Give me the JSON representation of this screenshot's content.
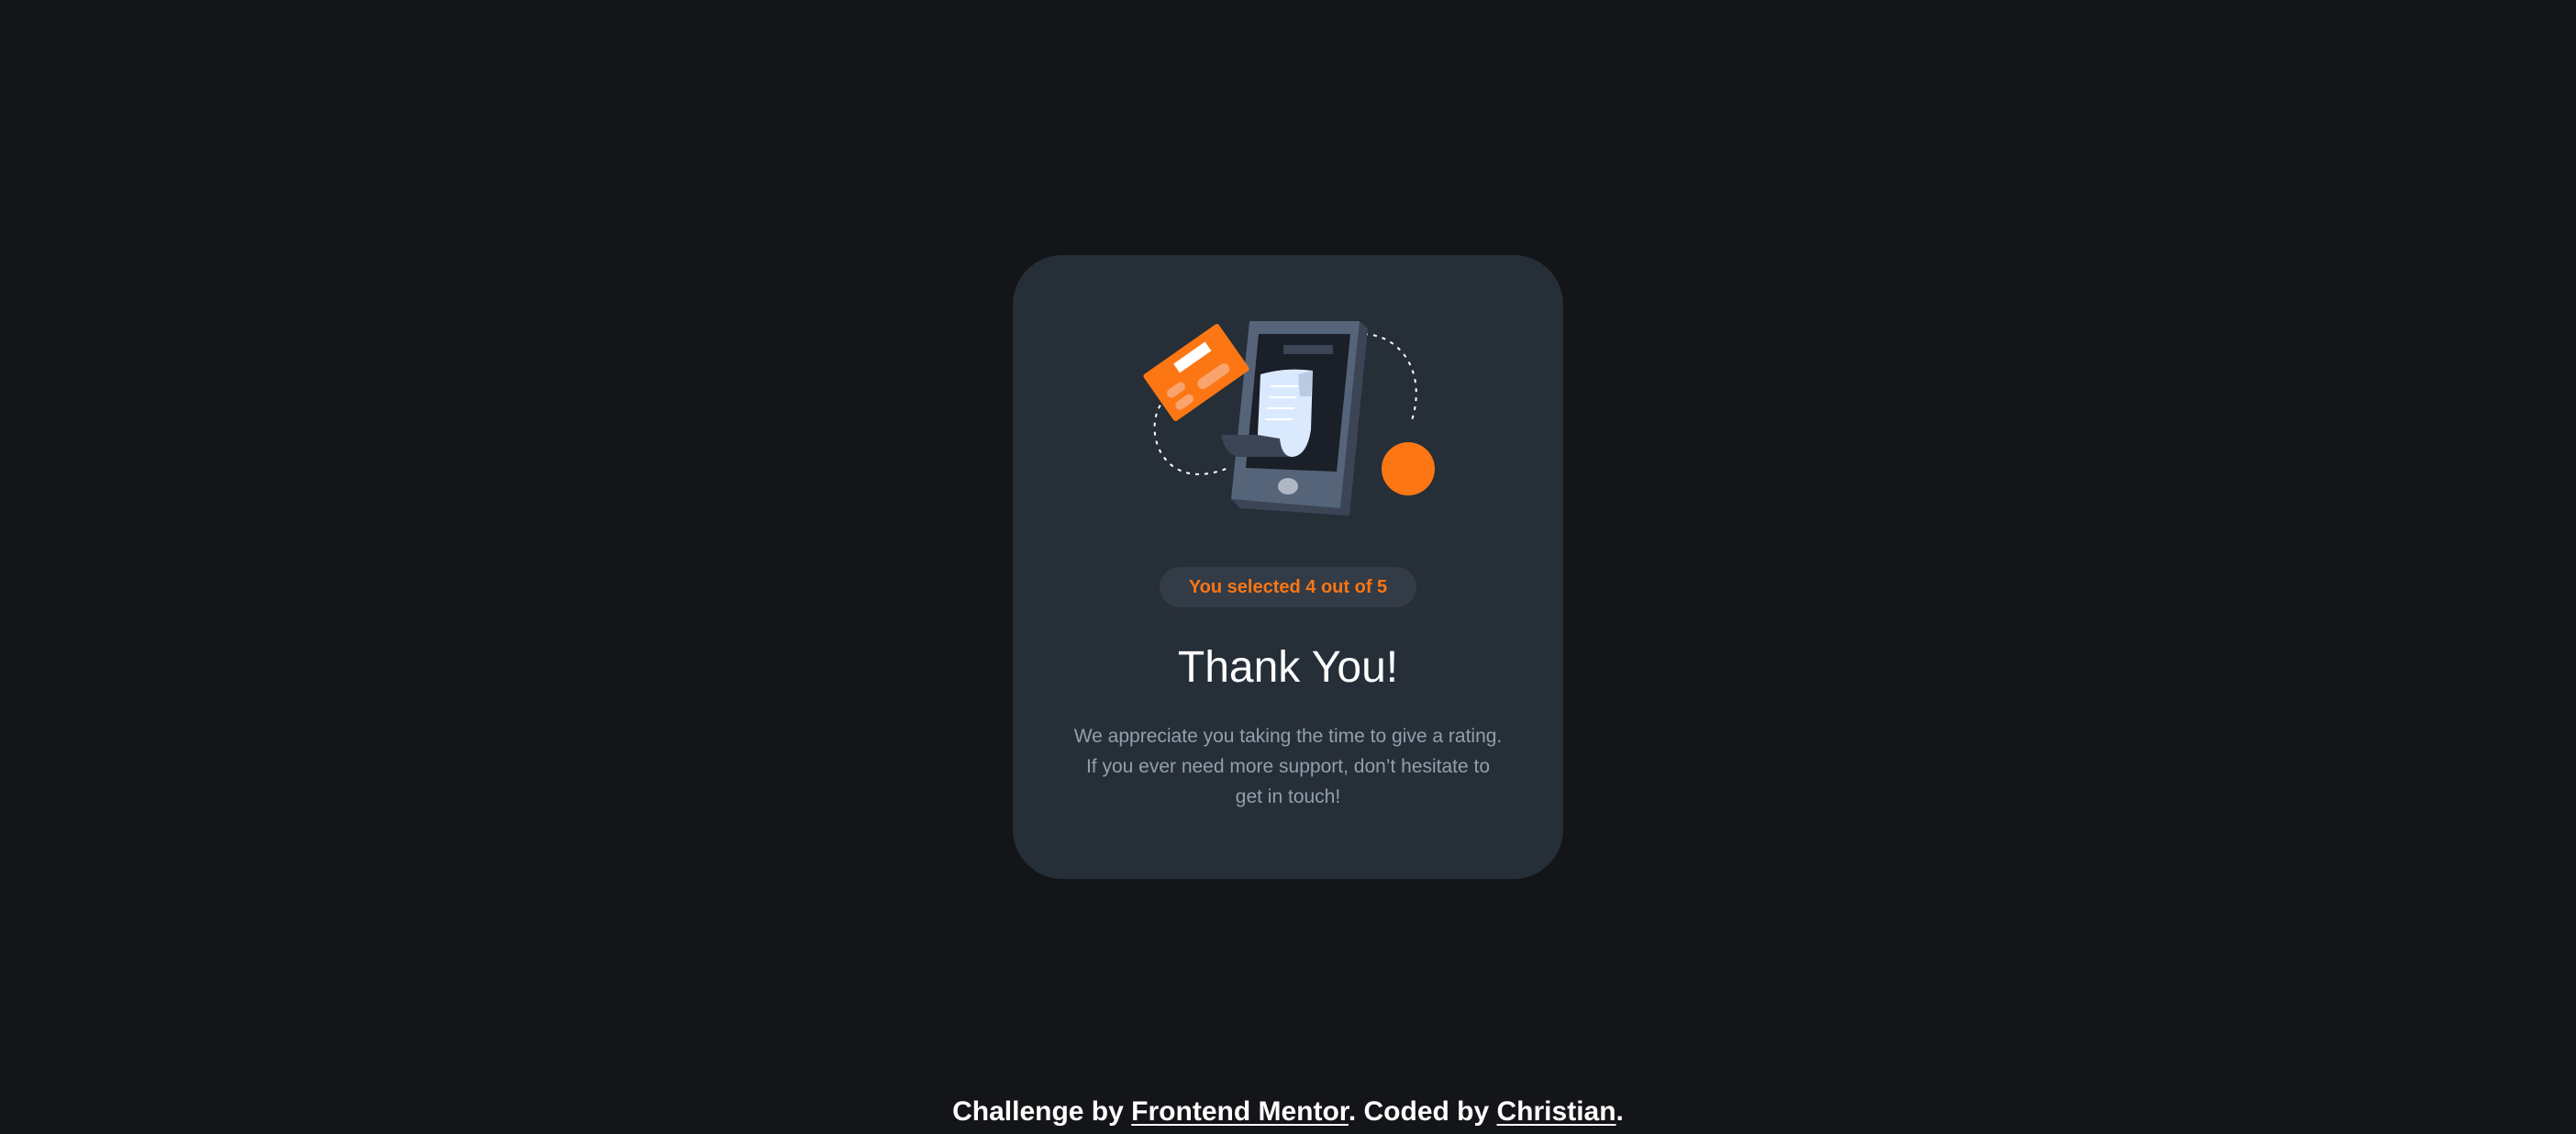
{
  "card": {
    "illustration": {
      "name": "thank-you-illustration",
      "colors": {
        "phone": "#556479",
        "phone_side": "#3b4555",
        "screen": "#1a1f28",
        "receipt": "#dbe9ff",
        "card": "#fc7614",
        "coin": "#fc7614"
      }
    },
    "badge": {
      "text": "You selected 4 out of 5"
    },
    "title": "Thank You!",
    "message": {
      "line1": "We appreciate you taking the time to give a rating.",
      "line2": "If you ever need more support, don’t hesitate to",
      "line3": "get in touch!"
    }
  },
  "attribution": {
    "prefix": "Challenge by",
    "challenge_link": "Frontend Mentor",
    "middle": ". Coded by",
    "author_link": "Christian",
    "suffix": "."
  },
  "colors": {
    "background": "#131518",
    "card": "#262e38",
    "badge_bg": "#323b46",
    "accent": "#fc7614",
    "heading": "#ffffff",
    "body_text": "#959eac"
  }
}
